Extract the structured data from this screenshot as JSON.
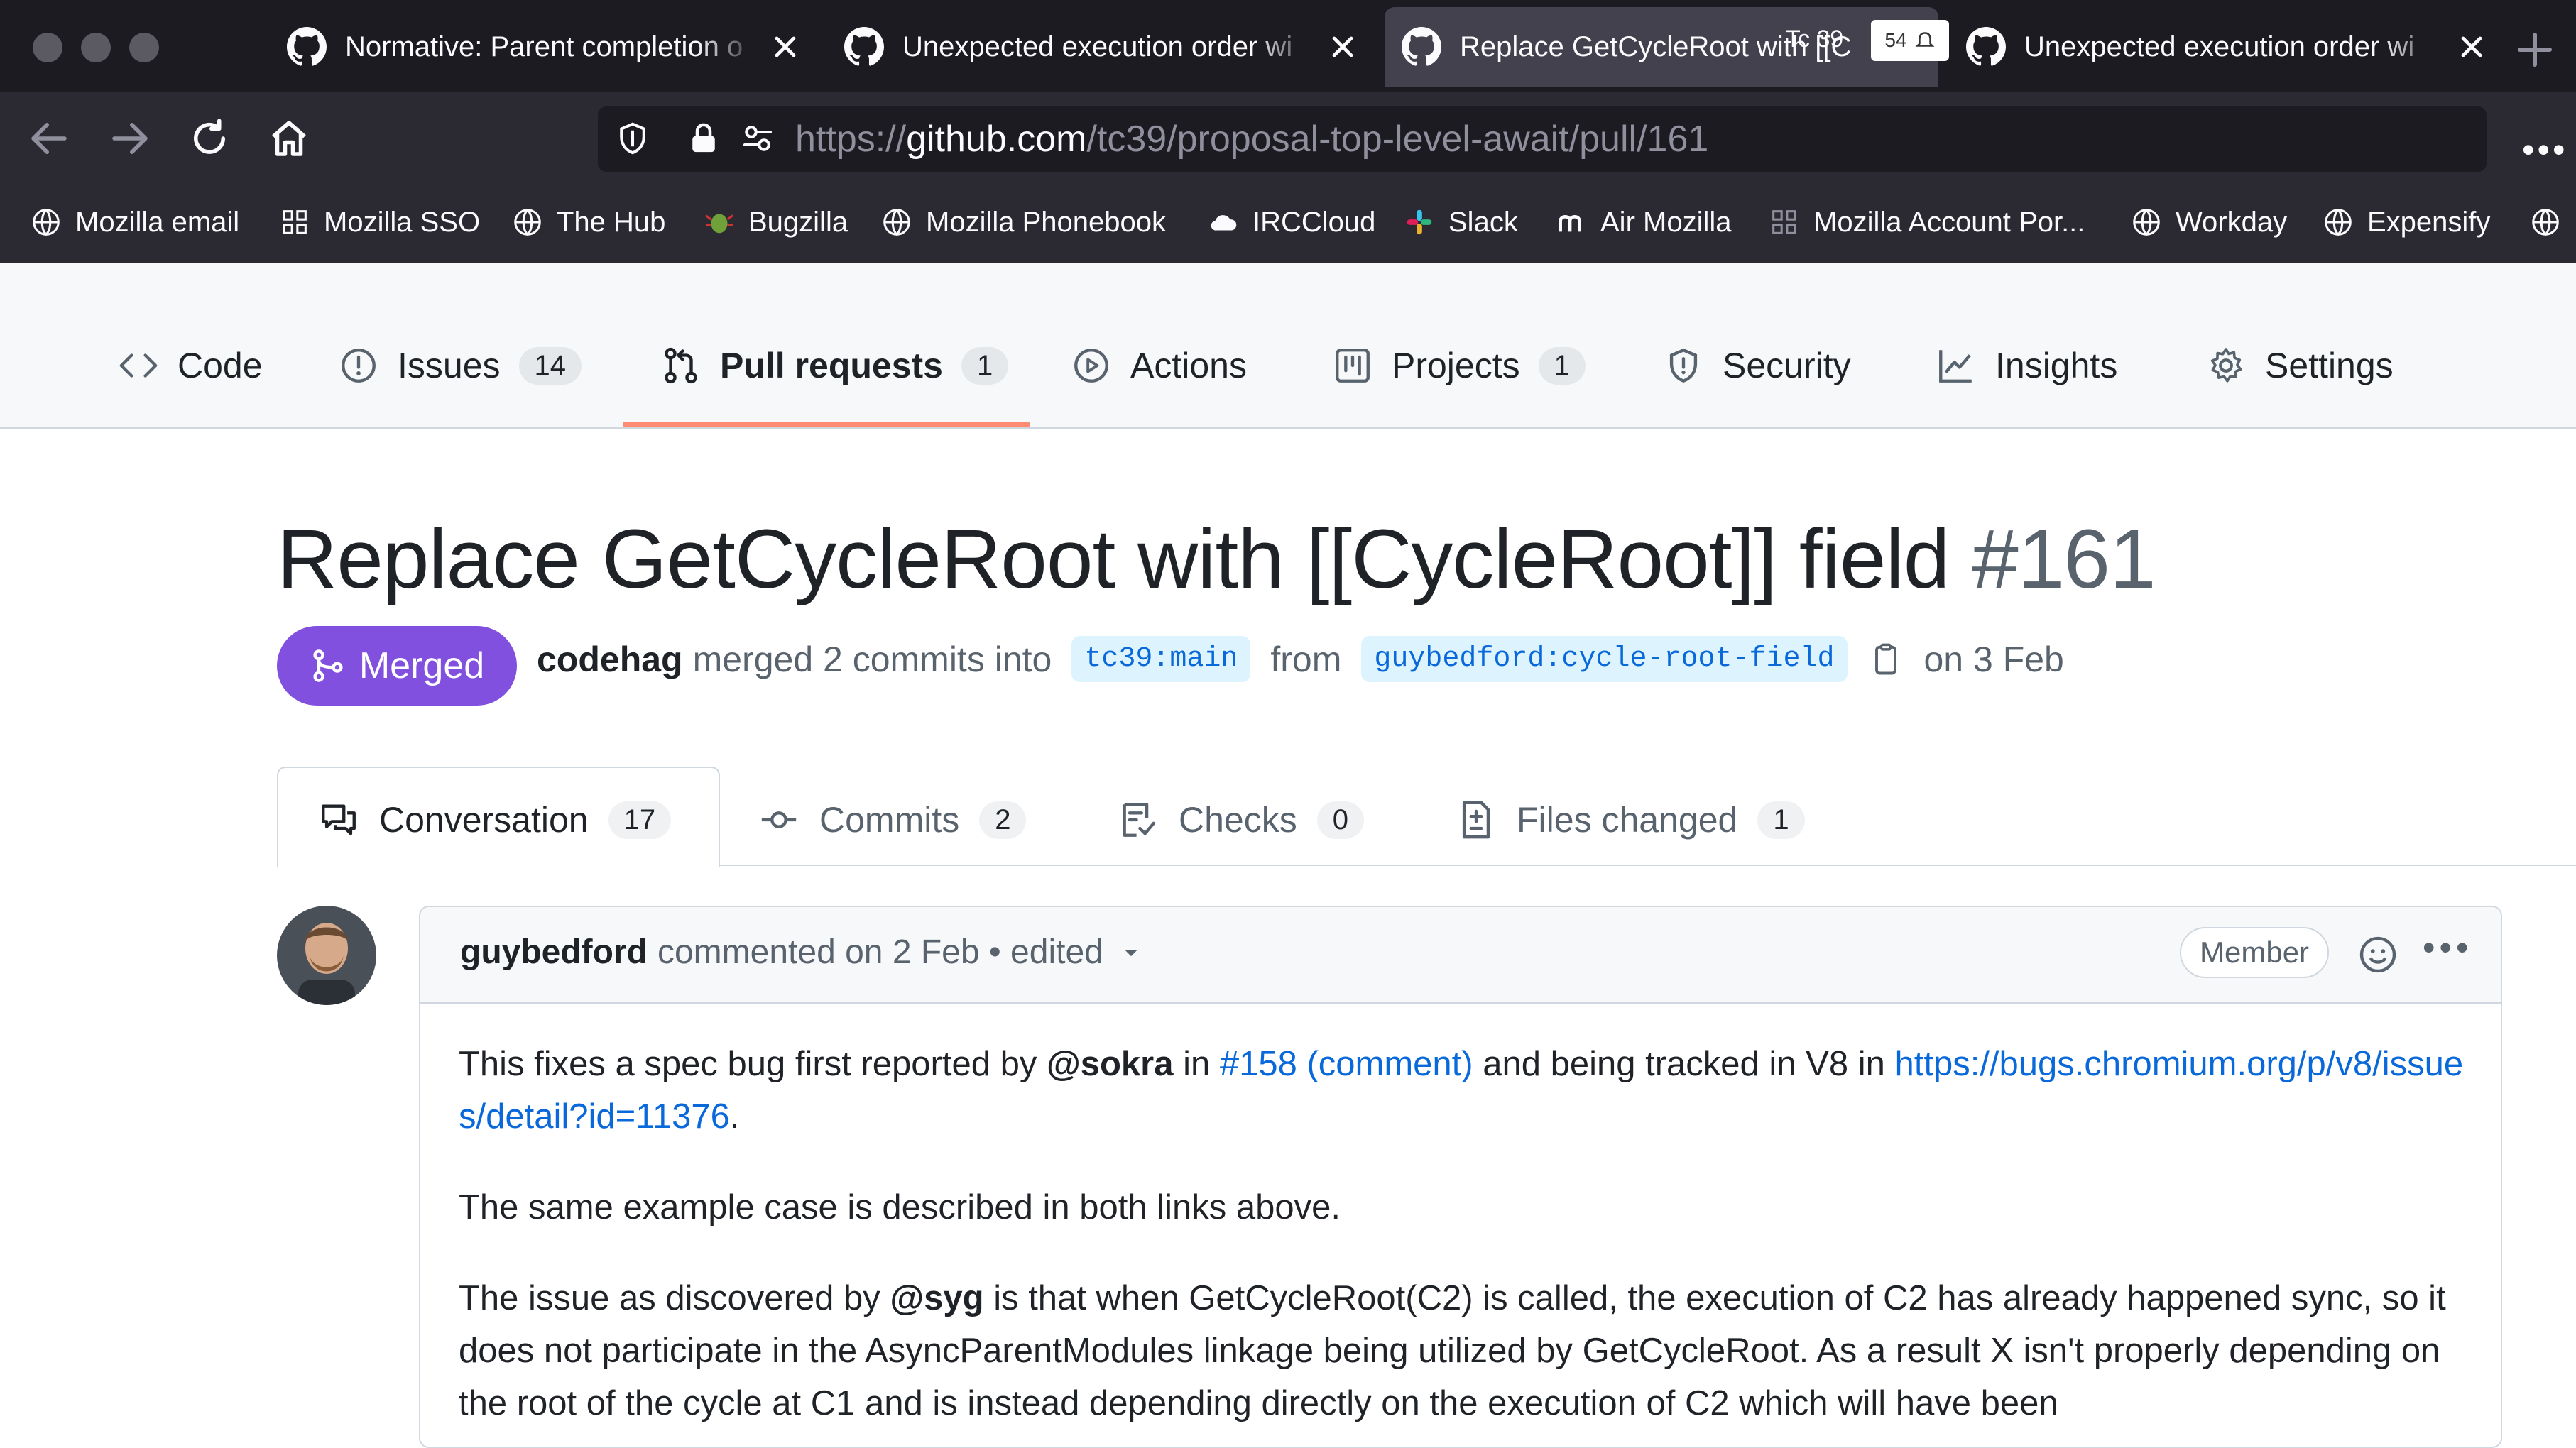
{
  "browser": {
    "tabs": [
      {
        "title": "Normative: Parent completion o",
        "close": "close-tab"
      },
      {
        "title": "Unexpected execution order wi",
        "close": "close-tab"
      },
      {
        "title": "Replace GetCycleRoot with [[C",
        "close": "close-tab"
      },
      {
        "title": "Unexpected execution order wi",
        "close": "close-tab"
      }
    ],
    "tab_badge": "Tc 39",
    "counter_badge": "54",
    "url": {
      "scheme": "https://",
      "host": "github.com",
      "path": "/tc39/proposal-top-level-await/pull/161"
    },
    "bookmarks": [
      "Mozilla email",
      "Mozilla SSO",
      "The Hub",
      "Bugzilla",
      "Mozilla Phonebook",
      "IRCCloud",
      "Slack",
      "Air Mozilla",
      "Mozilla Account Por...",
      "Workday",
      "Expensify"
    ]
  },
  "repo_nav": {
    "code": "Code",
    "issues": "Issues",
    "issues_count": "14",
    "pull_requests": "Pull requests",
    "pull_requests_count": "1",
    "actions": "Actions",
    "projects": "Projects",
    "projects_count": "1",
    "security": "Security",
    "insights": "Insights",
    "settings": "Settings"
  },
  "pr": {
    "title": "Replace GetCycleRoot with [[CycleRoot]] field",
    "number": "#161",
    "state": "Merged",
    "author": "codehag",
    "merge_text": "merged 2 commits into",
    "base_branch": "tc39:main",
    "from_text": "from",
    "head_branch": "guybedford:cycle-root-field",
    "date_text": "on 3 Feb"
  },
  "pr_tabs": {
    "conversation": "Conversation",
    "conversation_count": "17",
    "commits": "Commits",
    "commits_count": "2",
    "checks": "Checks",
    "checks_count": "0",
    "files_changed": "Files changed",
    "files_changed_count": "1"
  },
  "comment": {
    "author": "guybedford",
    "meta": "commented on 2 Feb • edited",
    "role": "Member",
    "p1_a": "This fixes a spec bug first reported by ",
    "p1_mention": "@sokra",
    "p1_b": " in ",
    "p1_link1": "#158 (comment)",
    "p1_c": " and being tracked in V8 in ",
    "p1_link2": "https://bugs.chromium.org/p/v8/issues/detail?id=11376",
    "p1_d": ".",
    "p2": "The same example case is described in both links above.",
    "p3_a": "The issue as discovered by ",
    "p3_mention": "@syg",
    "p3_b": " is that when GetCycleRoot(C2) is called, the execution of C2 has already happened sync, so it does not participate in the AsyncParentModules linkage being utilized by GetCycleRoot. As a result X isn't properly depending on the root of the cycle at C1 and is instead depending directly on the execution of C2 which will have been"
  },
  "colors": {
    "accent_merged": "#8250df",
    "link": "#0969da",
    "tab_underline": "#fd8c73",
    "chrome_bg": "#2b2a33"
  },
  "icons": {
    "github": "github-mark-icon",
    "back": "arrow-left-icon",
    "forward": "arrow-right-icon",
    "reload": "reload-icon",
    "home": "home-icon",
    "shield": "shield-icon",
    "lock": "lock-icon",
    "permissions": "sliders-icon"
  }
}
